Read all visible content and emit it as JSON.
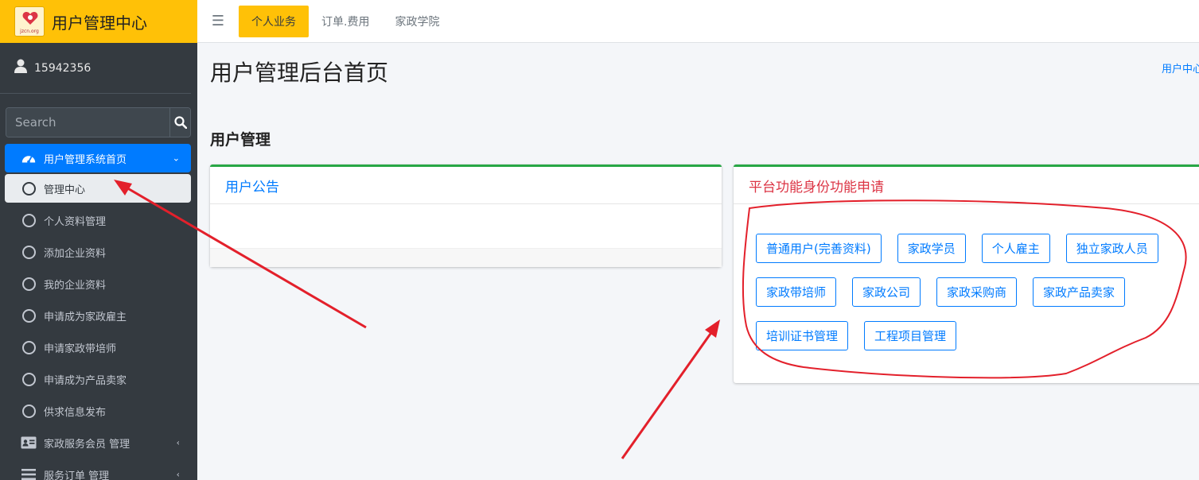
{
  "brand": {
    "title": "用户管理中心",
    "logo_text": "jzcn.org"
  },
  "user": {
    "name": "15942356"
  },
  "search": {
    "placeholder": "Search"
  },
  "sidebar": {
    "items": [
      {
        "label": "用户管理系统首页",
        "icon": "dashboard-icon"
      },
      {
        "label": "管理中心",
        "icon": "circle-icon"
      },
      {
        "label": "个人资料管理",
        "icon": "circle-icon"
      },
      {
        "label": "添加企业资料",
        "icon": "circle-icon"
      },
      {
        "label": "我的企业资料",
        "icon": "circle-icon"
      },
      {
        "label": "申请成为家政雇主",
        "icon": "circle-icon"
      },
      {
        "label": "申请家政带培师",
        "icon": "circle-icon"
      },
      {
        "label": "申请成为产品卖家",
        "icon": "circle-icon"
      },
      {
        "label": "供求信息发布",
        "icon": "circle-icon"
      },
      {
        "label": "家政服务会员 管理",
        "icon": "id-card-icon"
      },
      {
        "label": "服务订单 管理",
        "icon": "list-icon"
      }
    ]
  },
  "topnav": {
    "tabs": [
      "个人业务",
      "订单.费用",
      "家政学院"
    ]
  },
  "page": {
    "title": "用户管理后台首页",
    "breadcrumb": "用户中心"
  },
  "section": {
    "title": "用户管理"
  },
  "notice_card": {
    "title": "用户公告"
  },
  "apply_card": {
    "title": "平台功能身份功能申请",
    "rows": [
      [
        "普通用户(完善资料)",
        "家政学员",
        "个人雇主",
        "独立家政人员"
      ],
      [
        "家政带培师",
        "家政公司",
        "家政采购商",
        "家政产品卖家"
      ],
      [
        "培训证书管理",
        "工程项目管理"
      ]
    ]
  },
  "colors": {
    "brand": "#ffc107",
    "sidebar": "#343a40",
    "primary": "#007bff",
    "danger": "#dc3545",
    "success": "#28a745",
    "annotation": "#e3202b"
  }
}
